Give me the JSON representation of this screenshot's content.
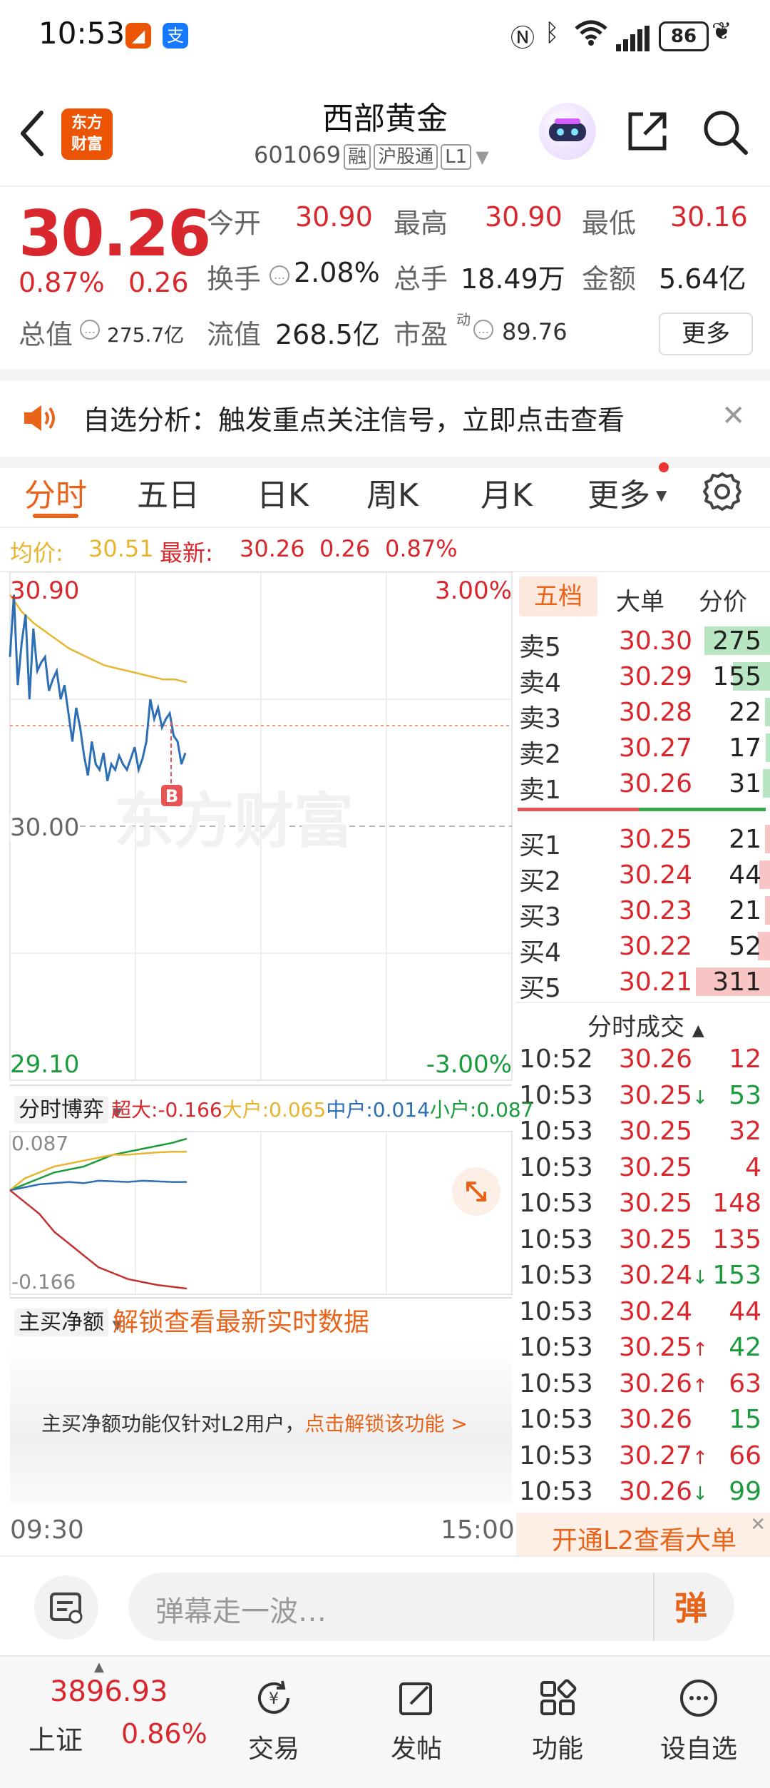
{
  "status_bar": {
    "time": "10:53",
    "battery": "86"
  },
  "header": {
    "logo_line1": "东方",
    "logo_line2": "财富",
    "title": "西部黄金",
    "code": "601069",
    "tags": [
      "融",
      "沪股通",
      "L1"
    ]
  },
  "quote": {
    "price": "30.26",
    "change_pct": "0.87%",
    "change": "0.26",
    "open_label": "今开",
    "open": "30.90",
    "high_label": "最高",
    "high": "30.90",
    "low_label": "最低",
    "low": "30.16",
    "turnover_label": "换手",
    "turnover": "2.08%",
    "volume_label": "总手",
    "volume": "18.49万",
    "amount_label": "金额",
    "amount": "5.64亿",
    "mktcap_label": "总值",
    "mktcap": "275.7亿",
    "float_label": "流值",
    "float_cap": "268.5亿",
    "pe_label": "市盈",
    "pe_sup": "动",
    "pe": "89.76",
    "more": "更多"
  },
  "alert": {
    "text": "自选分析：触发重点关注信号，立即点击查看"
  },
  "tabs": [
    "分时",
    "五日",
    "日K",
    "周K",
    "月K",
    "更多"
  ],
  "summary": {
    "avg_label": "均价:",
    "avg": "30.51",
    "latest_label": "最新:",
    "latest": "30.26",
    "chg": "0.26",
    "pct": "0.87%"
  },
  "chart_data": {
    "type": "line",
    "y_top": "30.90",
    "y_mid": "30.00",
    "y_bottom": "29.10",
    "pct_top": "3.00%",
    "pct_bottom": "-3.00%",
    "x_start": "09:30",
    "x_end": "15:00",
    "ylim": [
      29.1,
      30.9
    ],
    "watermark": "东方财富",
    "marker": "B",
    "series": [
      {
        "values": [
          30.6,
          30.82,
          30.5,
          30.65,
          30.75,
          30.45,
          30.7,
          30.55,
          30.58,
          30.6,
          30.48,
          30.52,
          30.55,
          30.45,
          30.5,
          30.4,
          30.3,
          30.42,
          30.35,
          30.25,
          30.18,
          30.3,
          30.22,
          30.2,
          30.26,
          30.16,
          30.22,
          30.2,
          30.25,
          30.22,
          30.2,
          30.24,
          30.28,
          30.2,
          30.24,
          30.3,
          30.45,
          30.38,
          30.42,
          30.35,
          30.38,
          30.4,
          30.32,
          30.3,
          30.22,
          30.26
        ]
      },
      {
        "values": [
          30.82,
          30.76,
          30.72,
          30.69,
          30.66,
          30.63,
          30.61,
          30.59,
          30.57,
          30.56,
          30.55,
          30.54,
          30.53,
          30.52,
          30.52,
          30.51
        ]
      }
    ]
  },
  "flow_chart": {
    "title": "分时博弈",
    "super_label": "超大:",
    "super": "-0.166",
    "large_label": "大户:",
    "large": "0.065",
    "mid_label": "中户:",
    "mid": "0.014",
    "small_label": "小户:",
    "small": "0.087",
    "y_max": "0.087",
    "y_min": "-0.166",
    "series": [
      {
        "values": [
          0.0,
          0.01,
          0.02,
          0.03,
          0.035,
          0.04,
          0.05,
          0.06,
          0.065,
          0.07,
          0.075,
          0.08,
          0.087
        ]
      },
      {
        "values": [
          0.0,
          0.02,
          0.03,
          0.04,
          0.045,
          0.05,
          0.055,
          0.06,
          0.06,
          0.062,
          0.064,
          0.065,
          0.065
        ]
      },
      {
        "values": [
          0.0,
          0.005,
          0.01,
          0.012,
          0.014,
          0.012,
          0.016,
          0.015,
          0.014,
          0.016,
          0.015,
          0.014,
          0.014
        ]
      },
      {
        "values": [
          0.0,
          -0.02,
          -0.04,
          -0.07,
          -0.09,
          -0.11,
          -0.13,
          -0.14,
          -0.15,
          -0.155,
          -0.16,
          -0.163,
          -0.166
        ]
      }
    ]
  },
  "net_buy": {
    "title": "主买净额",
    "unlock": "解锁查看最新实时数据",
    "notice": "主买净额功能仅针对L2用户，",
    "notice_link": "点击解锁该功能 >"
  },
  "book": {
    "tabs": [
      "五档",
      "大单",
      "分价"
    ],
    "asks": [
      {
        "label": "卖5",
        "price": "30.30",
        "vol": "275"
      },
      {
        "label": "卖4",
        "price": "30.29",
        "vol": "155"
      },
      {
        "label": "卖3",
        "price": "30.28",
        "vol": "22"
      },
      {
        "label": "卖2",
        "price": "30.27",
        "vol": "17"
      },
      {
        "label": "卖1",
        "price": "30.26",
        "vol": "31"
      }
    ],
    "bids": [
      {
        "label": "买1",
        "price": "30.25",
        "vol": "21"
      },
      {
        "label": "买2",
        "price": "30.24",
        "vol": "44"
      },
      {
        "label": "买3",
        "price": "30.23",
        "vol": "21"
      },
      {
        "label": "买4",
        "price": "30.22",
        "vol": "52"
      },
      {
        "label": "买5",
        "price": "30.21",
        "vol": "311"
      }
    ],
    "trades_title": "分时成交",
    "trades": [
      {
        "t": "10:52",
        "p": "30.26",
        "arrow": "",
        "v": "12",
        "dir": "up"
      },
      {
        "t": "10:53",
        "p": "30.25",
        "arrow": "↓",
        "v": "53",
        "dir": "down"
      },
      {
        "t": "10:53",
        "p": "30.25",
        "arrow": "",
        "v": "32",
        "dir": "up"
      },
      {
        "t": "10:53",
        "p": "30.25",
        "arrow": "",
        "v": "4",
        "dir": "up"
      },
      {
        "t": "10:53",
        "p": "30.25",
        "arrow": "",
        "v": "148",
        "dir": "up"
      },
      {
        "t": "10:53",
        "p": "30.25",
        "arrow": "",
        "v": "135",
        "dir": "up"
      },
      {
        "t": "10:53",
        "p": "30.24",
        "arrow": "↓",
        "v": "153",
        "dir": "down"
      },
      {
        "t": "10:53",
        "p": "30.24",
        "arrow": "",
        "v": "44",
        "dir": "up"
      },
      {
        "t": "10:53",
        "p": "30.25",
        "arrow": "↑",
        "v": "42",
        "dir": "down"
      },
      {
        "t": "10:53",
        "p": "30.26",
        "arrow": "↑",
        "v": "63",
        "dir": "up"
      },
      {
        "t": "10:53",
        "p": "30.26",
        "arrow": "",
        "v": "15",
        "dir": "down"
      },
      {
        "t": "10:53",
        "p": "30.27",
        "arrow": "↑",
        "v": "66",
        "dir": "up"
      },
      {
        "t": "10:53",
        "p": "30.26",
        "arrow": "↓",
        "v": "99",
        "dir": "down"
      }
    ],
    "l2_banner": "开通L2查看大单"
  },
  "input": {
    "placeholder": "弹幕走一波…",
    "danmu_btn": "弹"
  },
  "bottom_nav": {
    "index_value": "3896.93",
    "index_name": "上证",
    "index_pct": "0.86%",
    "items": [
      "交易",
      "发帖",
      "功能",
      "设自选"
    ]
  },
  "colors": {
    "up": "#d9272e",
    "down": "#1a9b3c",
    "accent": "#e8641b",
    "avg_line": "#e8b530",
    "price_line": "#2d6fb4"
  }
}
